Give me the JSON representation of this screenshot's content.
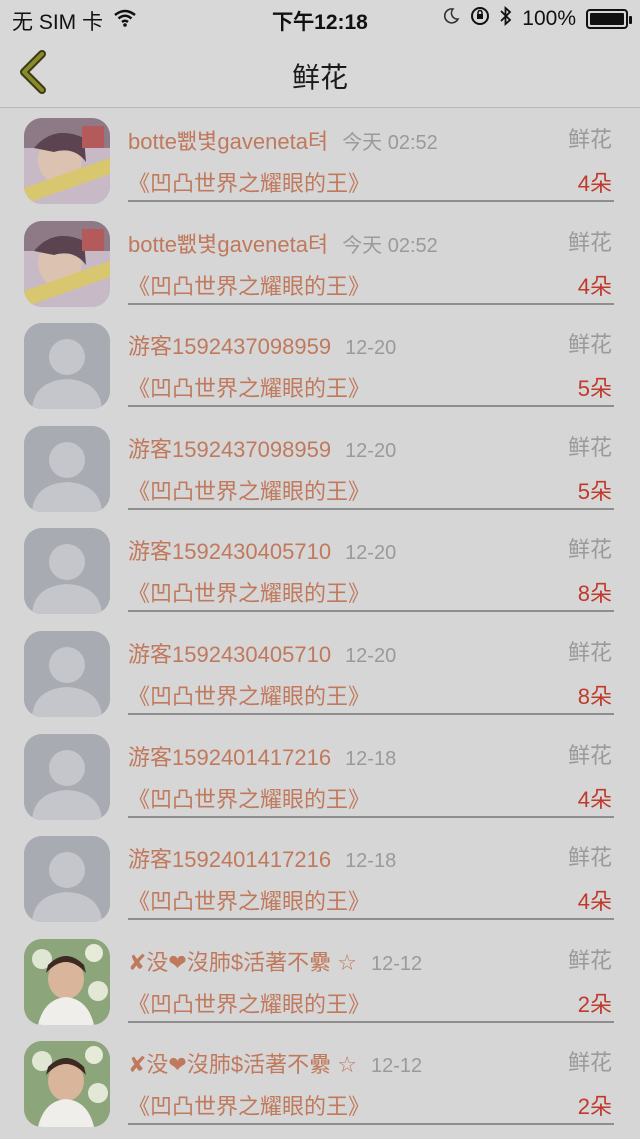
{
  "status_bar": {
    "carrier": "无 SIM 卡",
    "time": "下午12:18",
    "battery": "100%"
  },
  "nav": {
    "title": "鲜花"
  },
  "rows": [
    {
      "name": "botte뾊볓gaveneta텨",
      "time": "今天 02:52",
      "gift": "鲜花",
      "book": "《凹凸世界之耀眼的王》",
      "count": "4朵",
      "avatar": "photo-user"
    },
    {
      "name": "botte뾊볓gaveneta텨",
      "time": "今天 02:52",
      "gift": "鲜花",
      "book": "《凹凸世界之耀眼的王》",
      "count": "4朵",
      "avatar": "photo-user"
    },
    {
      "name": "游客1592437098959",
      "time": "12-20",
      "gift": "鲜花",
      "book": "《凹凸世界之耀眼的王》",
      "count": "5朵",
      "avatar": "default-user"
    },
    {
      "name": "游客1592437098959",
      "time": "12-20",
      "gift": "鲜花",
      "book": "《凹凸世界之耀眼的王》",
      "count": "5朵",
      "avatar": "default-user"
    },
    {
      "name": "游客1592430405710",
      "time": "12-20",
      "gift": "鲜花",
      "book": "《凹凸世界之耀眼的王》",
      "count": "8朵",
      "avatar": "default-user"
    },
    {
      "name": "游客1592430405710",
      "time": "12-20",
      "gift": "鲜花",
      "book": "《凹凸世界之耀眼的王》",
      "count": "8朵",
      "avatar": "default-user"
    },
    {
      "name": "游客1592401417216",
      "time": "12-18",
      "gift": "鲜花",
      "book": "《凹凸世界之耀眼的王》",
      "count": "4朵",
      "avatar": "default-user"
    },
    {
      "name": "游客1592401417216",
      "time": "12-18",
      "gift": "鲜花",
      "book": "《凹凸世界之耀眼的王》",
      "count": "4朵",
      "avatar": "default-user"
    },
    {
      "name": "✘没❤沒肺$活著不纍 ☆",
      "time": "12-12",
      "gift": "鲜花",
      "book": "《凹凸世界之耀眼的王》",
      "count": "2朵",
      "avatar": "photo-girl"
    },
    {
      "name": "✘没❤沒肺$活著不纍 ☆",
      "time": "12-12",
      "gift": "鲜花",
      "book": "《凹凸世界之耀眼的王》",
      "count": "2朵",
      "avatar": "photo-girl"
    }
  ]
}
